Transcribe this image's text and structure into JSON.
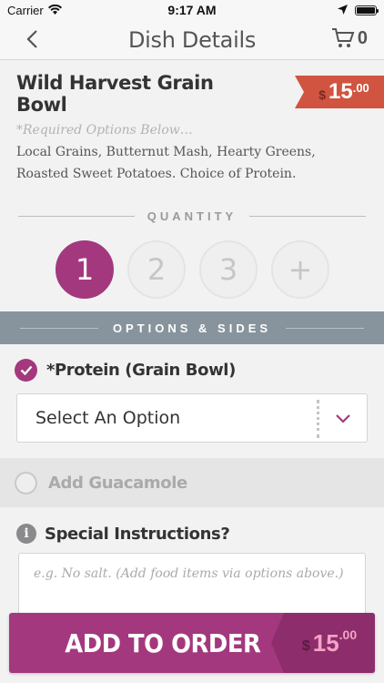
{
  "status_bar": {
    "carrier": "Carrier",
    "time": "9:17 AM"
  },
  "nav": {
    "title": "Dish Details",
    "cart_count": "0"
  },
  "dish": {
    "name": "Wild Harvest Grain Bowl",
    "required_note": "*Required Options Below…",
    "description": "Local Grains, Butternut Mash, Hearty Greens, Roasted Sweet Potatoes. Choice of Protein.",
    "price": {
      "currency": "$",
      "whole": "15",
      "cents": ".00"
    }
  },
  "quantity": {
    "label": "QUANTITY",
    "options": [
      "1",
      "2",
      "3",
      "+"
    ],
    "selected": "1"
  },
  "options": {
    "header": "OPTIONS & SIDES",
    "protein": {
      "label": "*Protein (Grain Bowl)",
      "checked": true,
      "select_value": "Select An Option"
    },
    "guacamole": {
      "label": "Add Guacamole",
      "checked": false
    }
  },
  "special": {
    "label": "Special Instructions?",
    "placeholder": "e.g. No salt. (Add food items via options above.)"
  },
  "add_button": {
    "label": "ADD TO ORDER",
    "price": {
      "currency": "$",
      "whole": "15",
      "cents": ".00"
    }
  },
  "colors": {
    "accent": "#a3387e",
    "price_tag": "#d0543f",
    "band": "#87949d"
  }
}
